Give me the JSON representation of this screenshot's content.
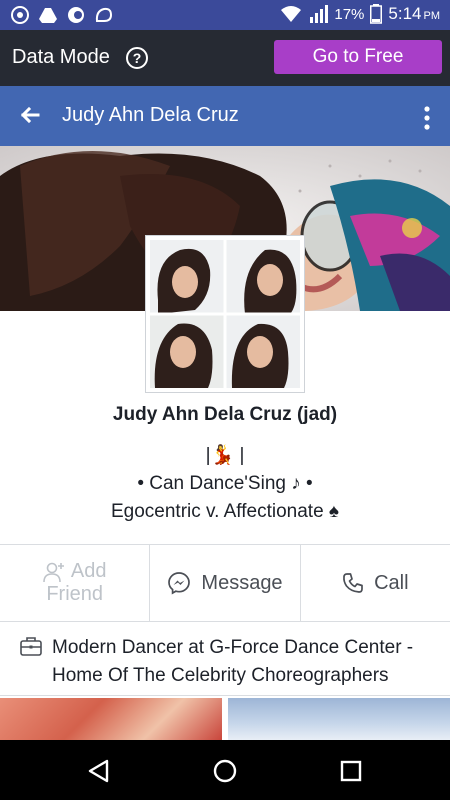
{
  "status_bar": {
    "battery_percent": "17%",
    "time": "5:14",
    "time_suffix": "PM",
    "icons": [
      "chrome-icon",
      "drive-icon",
      "circle-app-icon",
      "uc-browser-icon",
      "wifi-icon",
      "signal-icon",
      "battery-icon"
    ]
  },
  "data_bar": {
    "label": "Data Mode",
    "help_glyph": "?",
    "button_label": "Go to Free"
  },
  "header": {
    "title": "Judy Ahn Dela Cruz"
  },
  "profile": {
    "name": "Judy Ahn Dela Cruz  (jad)",
    "bio_lines": [
      "|💃 |",
      "• Can Dance'Sing ♪ •",
      "Egocentric v. Affectionate ♠"
    ]
  },
  "actions": {
    "add_friend_line1": "Add",
    "add_friend_line2": "Friend",
    "message": "Message",
    "call": "Call"
  },
  "work": {
    "text": "Modern Dancer at G-Force Dance Center - Home Of The Celebrity Choreographers"
  },
  "colors": {
    "status_bar": "#3b4a9a",
    "data_bar": "#262a33",
    "go_free": "#a83ec8",
    "header": "#4267b2"
  }
}
